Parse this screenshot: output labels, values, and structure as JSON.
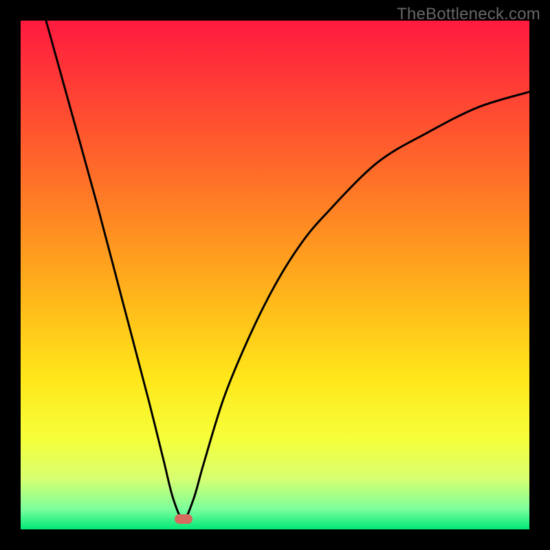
{
  "watermark": "TheBottleneck.com",
  "colors": {
    "frame": "#000000",
    "curve": "#000000",
    "marker": "#d66b5f",
    "gradient_stops": [
      {
        "pos": 0.0,
        "color": "#ff1a3f"
      },
      {
        "pos": 0.2,
        "color": "#ff5030"
      },
      {
        "pos": 0.4,
        "color": "#ff8a22"
      },
      {
        "pos": 0.55,
        "color": "#ffb81a"
      },
      {
        "pos": 0.7,
        "color": "#ffe61a"
      },
      {
        "pos": 0.82,
        "color": "#f6ff3a"
      },
      {
        "pos": 0.9,
        "color": "#d8ff70"
      },
      {
        "pos": 0.96,
        "color": "#7cff9c"
      },
      {
        "pos": 1.0,
        "color": "#00e878"
      }
    ]
  },
  "chart_data": {
    "type": "line",
    "title": "",
    "xlabel": "",
    "ylabel": "",
    "xlim": [
      0,
      100
    ],
    "ylim": [
      0,
      100
    ],
    "grid": false,
    "legend": false,
    "curve": {
      "minimum_x": 32,
      "minimum_y": 2,
      "points": [
        {
          "x": 5,
          "y": 100
        },
        {
          "x": 10,
          "y": 82
        },
        {
          "x": 15,
          "y": 64
        },
        {
          "x": 20,
          "y": 45
        },
        {
          "x": 25,
          "y": 26
        },
        {
          "x": 28,
          "y": 14
        },
        {
          "x": 30,
          "y": 6
        },
        {
          "x": 32,
          "y": 2
        },
        {
          "x": 34,
          "y": 6
        },
        {
          "x": 36,
          "y": 13
        },
        {
          "x": 40,
          "y": 26
        },
        {
          "x": 45,
          "y": 38
        },
        {
          "x": 50,
          "y": 48
        },
        {
          "x": 55,
          "y": 56
        },
        {
          "x": 60,
          "y": 62
        },
        {
          "x": 70,
          "y": 72
        },
        {
          "x": 80,
          "y": 78
        },
        {
          "x": 90,
          "y": 83
        },
        {
          "x": 100,
          "y": 86
        }
      ]
    },
    "marker": {
      "x": 32,
      "y": 2
    }
  }
}
